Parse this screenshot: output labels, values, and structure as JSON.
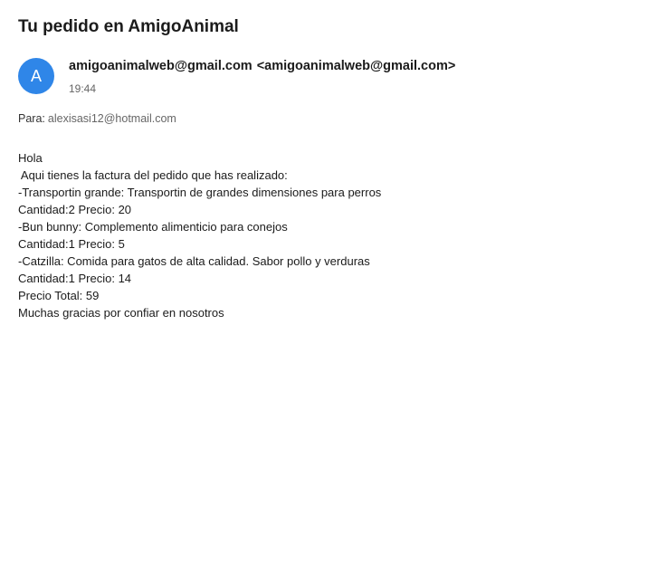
{
  "email": {
    "subject": "Tu pedido en AmigoAnimal",
    "avatar_letter": "A",
    "sender_name": "amigoanimalweb@gmail.com",
    "sender_address": "<amigoanimalweb@gmail.com>",
    "time": "19:44",
    "recipient_label": "Para:",
    "recipient_address": "alexisasi12@hotmail.com",
    "body_lines": [
      "Hola",
      " Aqui tienes la factura del pedido que has realizado:",
      "-Transportin grande: Transportin de grandes dimensiones para perros",
      "Cantidad:2 Precio: 20",
      "-Bun bunny: Complemento alimenticio para conejos",
      "Cantidad:1 Precio: 5",
      "-Catzilla: Comida para gatos de alta calidad. Sabor pollo y verduras",
      "Cantidad:1 Precio: 14",
      "Precio Total: 59",
      "Muchas gracias por confiar en nosotros"
    ]
  },
  "colors": {
    "avatar_background": "#2f86e8",
    "text_primary": "#1b1b1b",
    "text_secondary": "#666666"
  }
}
